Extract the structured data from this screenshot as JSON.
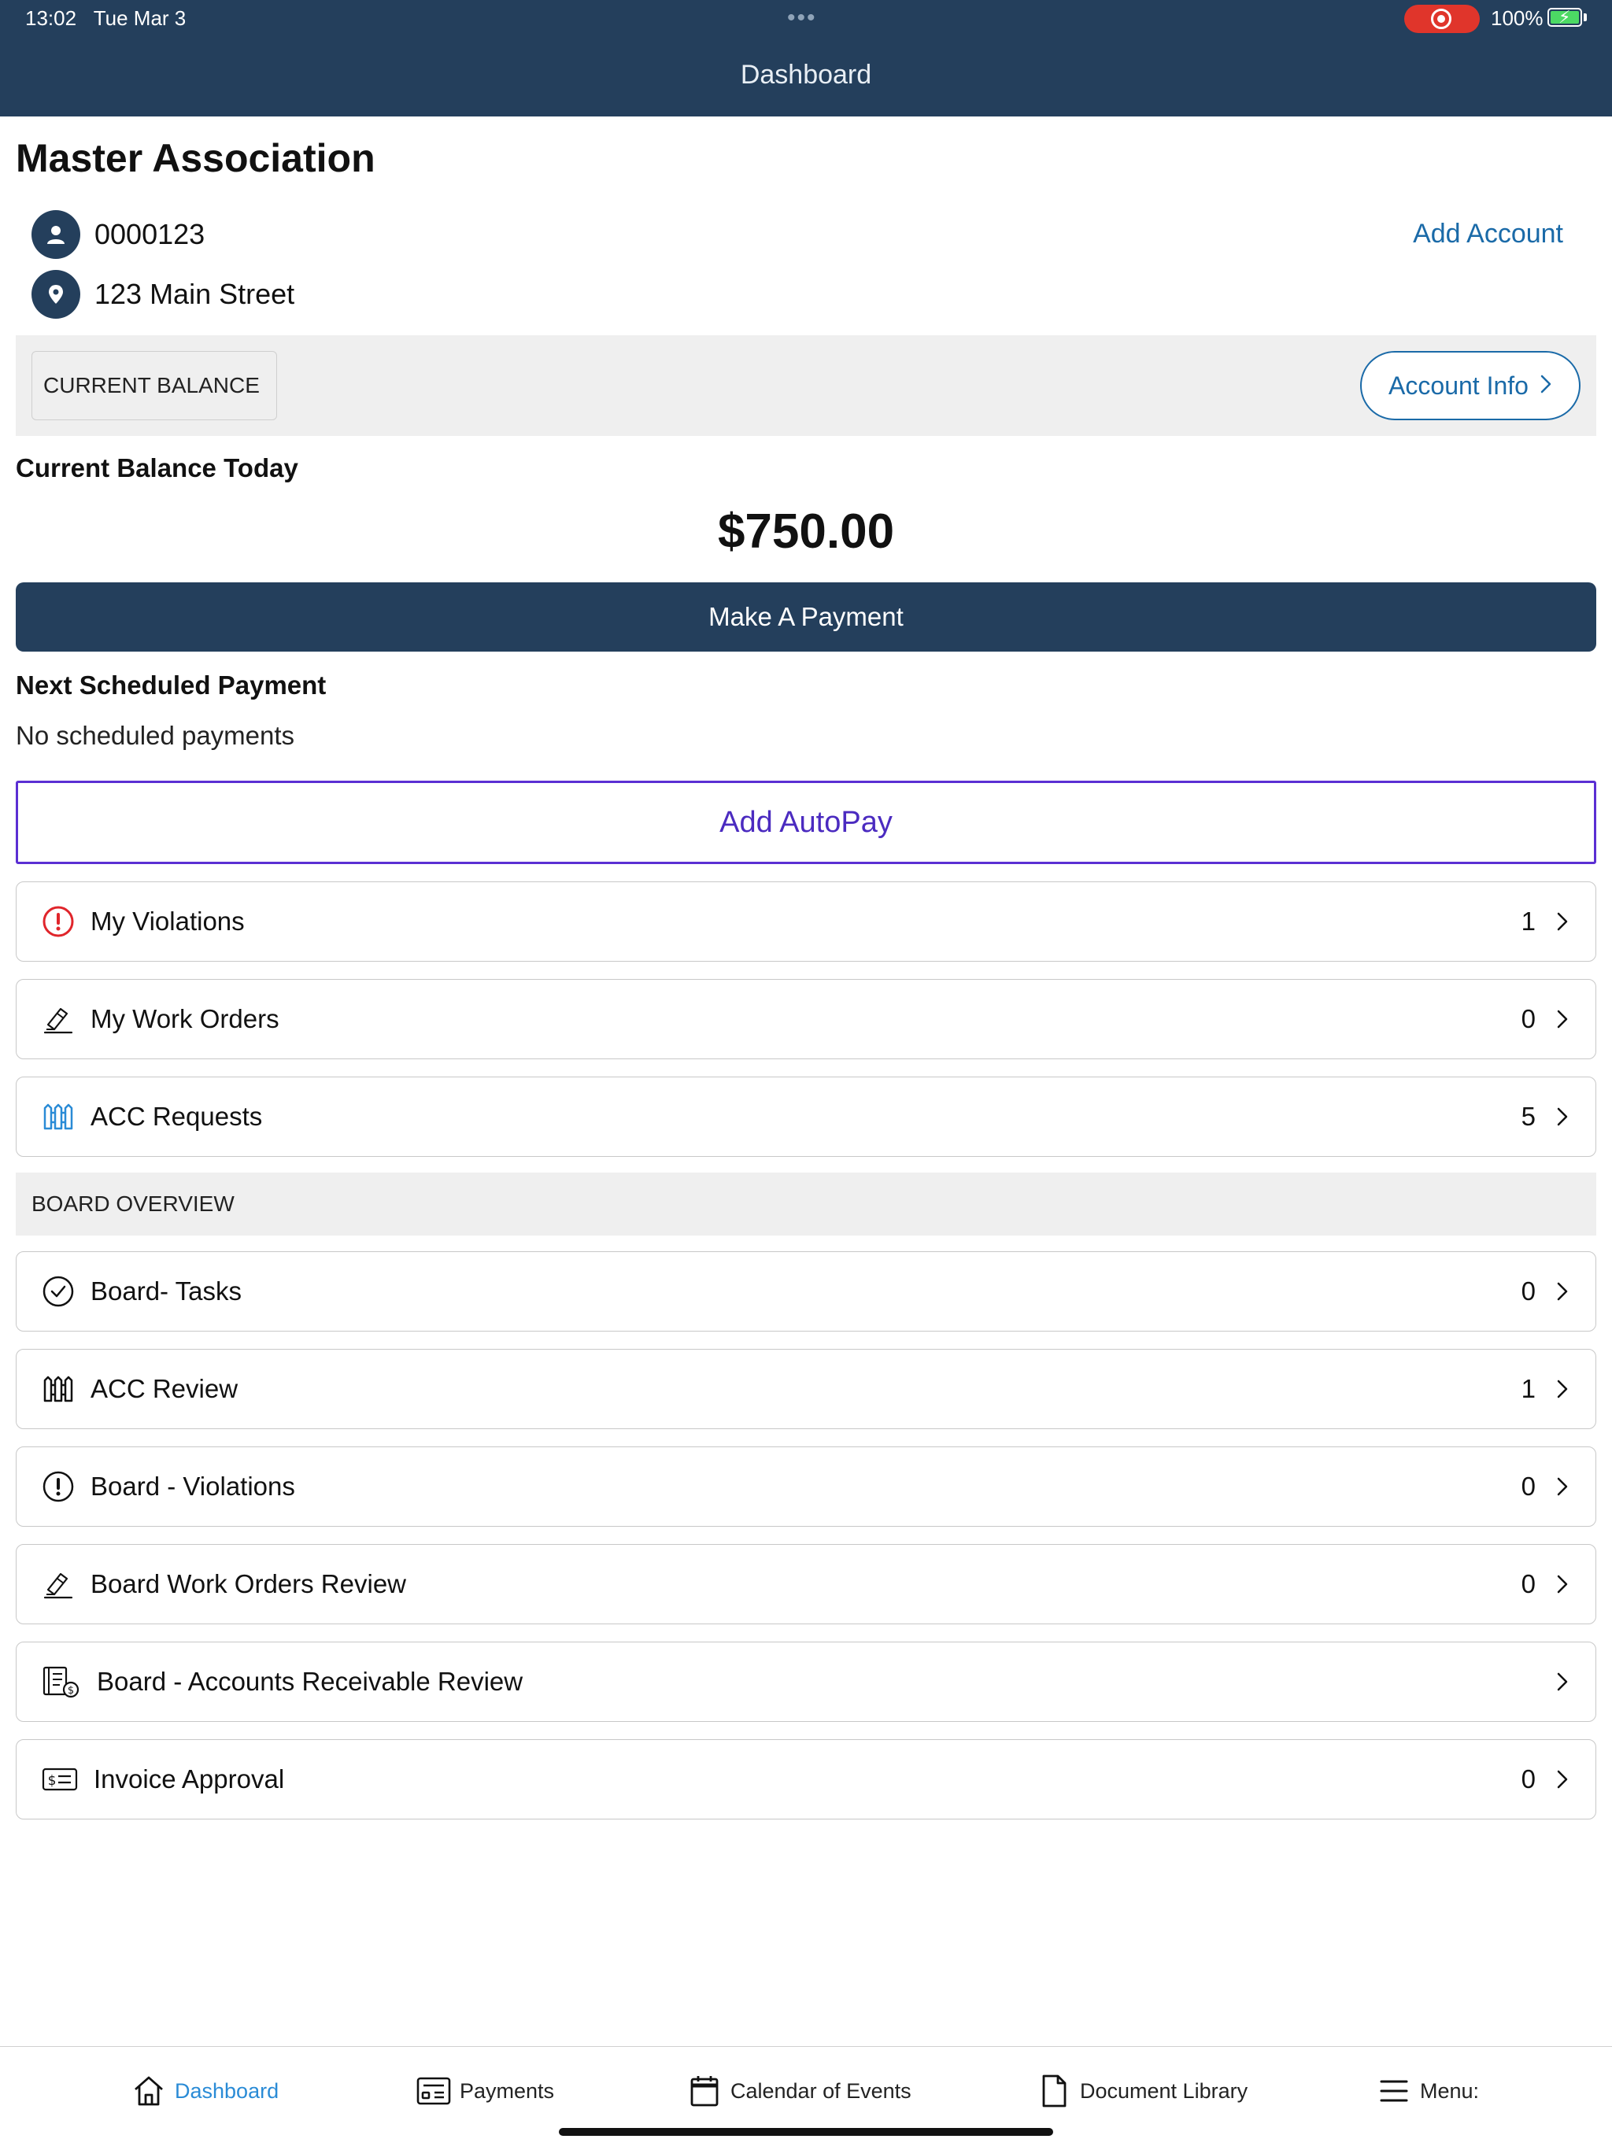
{
  "status_bar": {
    "time": "13:02",
    "date": "Tue Mar 3",
    "battery": "100%"
  },
  "nav": {
    "title": "Dashboard"
  },
  "association": {
    "name": "Master Association",
    "account_number": "0000123",
    "address": "123 Main Street",
    "add_account_label": "Add Account"
  },
  "balance": {
    "tab_label": "CURRENT BALANCE",
    "account_info_label": "Account Info",
    "today_label": "Current Balance Today",
    "amount": "$750.00",
    "pay_label": "Make A Payment"
  },
  "scheduled": {
    "title": "Next Scheduled Payment",
    "text": "No scheduled payments",
    "autopay_label": "Add AutoPay"
  },
  "owner_items": [
    {
      "label": "My Violations",
      "count": "1",
      "icon": "alert-circle-icon"
    },
    {
      "label": "My Work Orders",
      "count": "0",
      "icon": "hammer-icon"
    },
    {
      "label": "ACC Requests",
      "count": "5",
      "icon": "fence-icon"
    }
  ],
  "board": {
    "section_label": "BOARD OVERVIEW",
    "items": [
      {
        "label": "Board- Tasks",
        "count": "0",
        "icon": "check-circle-icon"
      },
      {
        "label": "ACC Review",
        "count": "1",
        "icon": "fence-icon"
      },
      {
        "label": "Board - Violations",
        "count": "0",
        "icon": "alert-circle-icon"
      },
      {
        "label": "Board Work Orders Review",
        "count": "0",
        "icon": "hammer-icon"
      },
      {
        "label": "Board - Accounts Receivable Review",
        "count": "",
        "icon": "receivable-icon"
      },
      {
        "label": "Invoice Approval",
        "count": "0",
        "icon": "invoice-icon"
      }
    ]
  },
  "tabs": [
    {
      "label": "Dashboard",
      "icon": "home-icon",
      "active": true
    },
    {
      "label": "Payments",
      "icon": "payment-card-icon",
      "active": false
    },
    {
      "label": "Calendar of Events",
      "icon": "calendar-icon",
      "active": false
    },
    {
      "label": "Document Library",
      "icon": "document-icon",
      "active": false
    },
    {
      "label": "Menu:",
      "icon": "menu-icon",
      "active": false
    }
  ],
  "colors": {
    "header": "#243f5c",
    "link": "#1a6aa8",
    "autopay": "#5b2fd3",
    "alert": "#e0252b",
    "acc_blue": "#2a8bd6",
    "active_tab": "#2a8bd6"
  }
}
